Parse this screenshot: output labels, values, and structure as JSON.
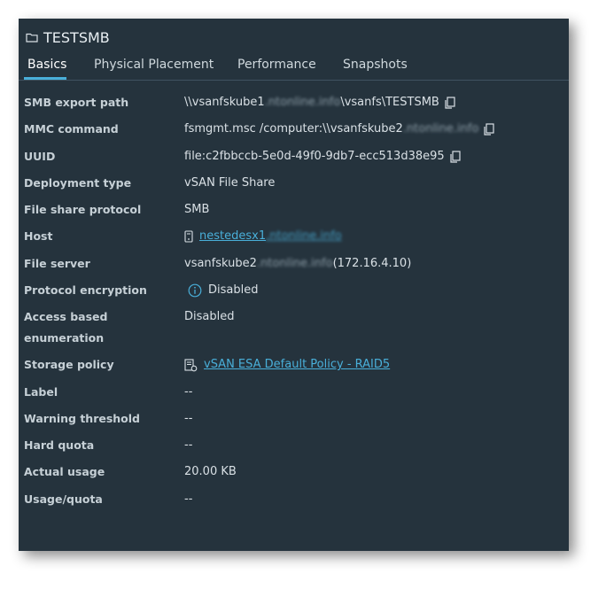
{
  "header": {
    "title": "TESTSMB",
    "folder_icon": "folder-icon"
  },
  "tabs": [
    {
      "label": "Basics",
      "active": true
    },
    {
      "label": "Physical Placement",
      "active": false
    },
    {
      "label": "Performance",
      "active": false
    },
    {
      "label": "Snapshots",
      "active": false
    }
  ],
  "fields": {
    "smb_export_path": {
      "label": "SMB export path",
      "pre": "\\\\vsanfskube1",
      "blurred": ".ntonline.info",
      "post": "\\vsanfs\\TESTSMB"
    },
    "mmc_command": {
      "label": "MMC command",
      "pre": "fsmgmt.msc /computer:\\\\vsanfskube2",
      "blurred": ".ntonline.info"
    },
    "uuid": {
      "label": "UUID",
      "value": "file:c2fbbccb-5e0d-49f0-9db7-ecc513d38e95"
    },
    "deployment_type": {
      "label": "Deployment type",
      "value": "vSAN File Share"
    },
    "file_share_protocol": {
      "label": "File share protocol",
      "value": "SMB"
    },
    "host": {
      "label": "Host",
      "pre": "nestedesx1",
      "blurred": ".ntonline.info"
    },
    "file_server": {
      "label": "File server",
      "pre": "vsanfskube2",
      "blurred": ".ntonline.info",
      "post": " (172.16.4.10)"
    },
    "protocol_encryption": {
      "label": "Protocol encryption",
      "value": "Disabled"
    },
    "access_based_enum": {
      "label_line1": "Access based",
      "label_line2": "enumeration",
      "value": "Disabled"
    },
    "storage_policy": {
      "label": "Storage policy",
      "value": "vSAN ESA Default Policy - RAID5"
    },
    "label_field": {
      "label": "Label",
      "value": "--"
    },
    "warning_threshold": {
      "label": "Warning threshold",
      "value": "--"
    },
    "hard_quota": {
      "label": "Hard quota",
      "value": "--"
    },
    "actual_usage": {
      "label": "Actual usage",
      "value": "20.00 KB"
    },
    "usage_quota": {
      "label": "Usage/quota",
      "value": "--"
    }
  },
  "colors": {
    "panel_bg": "#25333d",
    "accent": "#49afd9",
    "text": "#d9e0e5"
  }
}
